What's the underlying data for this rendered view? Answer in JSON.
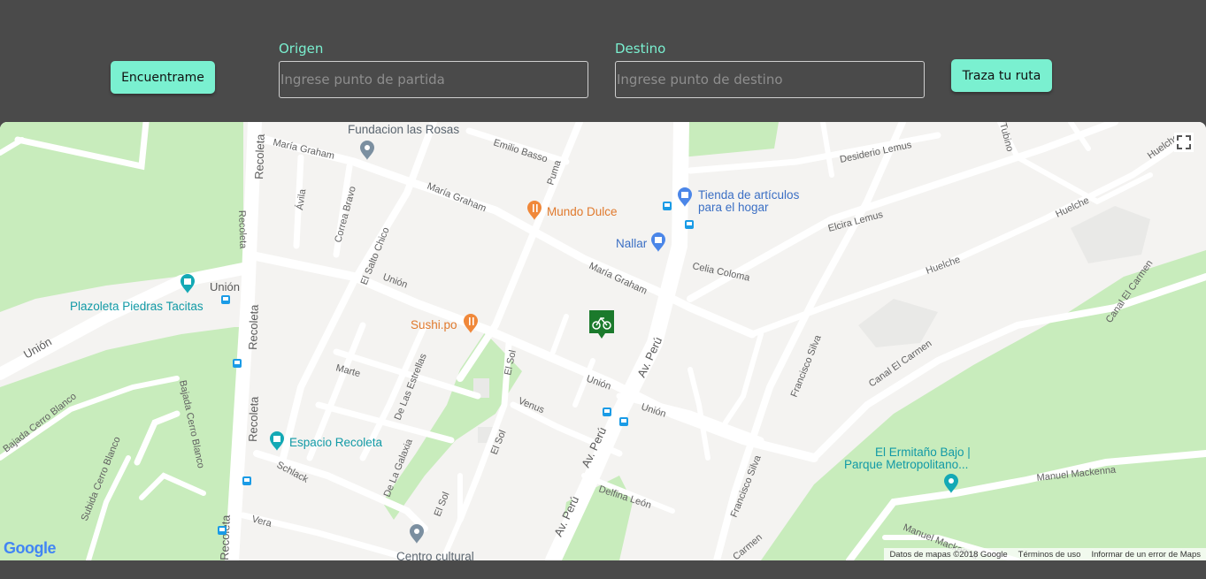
{
  "header": {
    "find_me": "Encuentrame",
    "origin": {
      "label": "Origen",
      "placeholder": "Ingrese punto de partida"
    },
    "destination": {
      "label": "Destino",
      "placeholder": "Ingrese punto de destino"
    },
    "route": "Traza tu ruta"
  },
  "map": {
    "pois": {
      "fundacion": "Fundacion las Rosas",
      "mundo_dulce": "Mundo Dulce",
      "tienda_1": "Tienda de artículos",
      "tienda_2": "para el hogar",
      "nallar": "Nallar",
      "plazoleta": "Plazoleta Piedras Tacitas",
      "sushi": "Sushi.po",
      "espacio": "Espacio Recoleta",
      "ermitano_1": "El Ermitaño Bajo |",
      "ermitano_2": "Parque Metropolitano...",
      "centro": "Centro cultural"
    },
    "streets": {
      "maria_graham_1": "María Graham",
      "maria_graham_2": "María Graham",
      "maria_graham_3": "María Graham",
      "emilio_basso": "Emilio Basso",
      "puma": "Puma",
      "avila": "Ávila",
      "correa_bravo": "Correa Bravo",
      "recoleta_1": "Recoleta",
      "recoleta_2": "Recoleta",
      "recoleta_3": "Recoleta",
      "recoleta_4": "Recoleta",
      "recoleta_5": "Recoleta",
      "union_1": "Unión",
      "union_2": "Unión",
      "union_3": "Unión",
      "union_4": "Unión",
      "union_5": "Unión",
      "el_salto_chico": "El Salto Chico",
      "marte": "Marte",
      "de_las_estrellas": "De Las Estrellas",
      "el_sol_1": "El Sol",
      "el_sol_2": "El Sol",
      "el_sol_3": "El Sol",
      "venus": "Venus",
      "de_la_galaxia": "De La Galaxia",
      "schlack": "Schlack",
      "vera": "Vera",
      "av_peru_1": "Av. Perú",
      "av_peru_2": "Av. Perú",
      "av_peru_3": "Av. Perú",
      "delfina_leon": "Delfina León",
      "celia_coloma": "Celia Coloma",
      "elcira_lemus": "Elcira Lemus",
      "desiderio_lemus": "Desiderio Lemus",
      "huelche_1": "Huelche",
      "huelche_2": "Huelche",
      "huelche_3": "Huelche",
      "tubino": "Tubino",
      "francisco_silva_1": "Francisco Silva",
      "francisco_silva_2": "Francisco Silva",
      "canal_el_carmen_1": "Canal El Carmen",
      "canal_el_carmen_2": "Canal El Carmen",
      "carmen": "Carmen",
      "manuel_mackenna_1": "Manuel Mackenna",
      "manuel_mackenna_2": "Manuel Mackenna",
      "bajada_cerro_blanco_1": "Bajada Cerro Blanco",
      "bajada_cerro_blanco_2": "Bajada Cerro Blanco",
      "subida_cerro_blanco": "Subida Cerro Blanco"
    },
    "google_logo": "Google",
    "attribution": {
      "data": "Datos de mapas ©2018 Google",
      "terms": "Términos de uso",
      "report": "Informar de un error de Maps"
    },
    "colors": {
      "park": "#c8ecbc",
      "road": "#ffffff",
      "land": "#f4f3f1",
      "teal_poi": "#14a9b5",
      "orange_poi": "#f0883a",
      "blue_poi": "#4b86e8",
      "bike": "#1b7a2c"
    },
    "icons": [
      "location-pin-icon",
      "restaurant-icon",
      "shopping-bag-icon",
      "museum-icon",
      "camera-icon",
      "bus-stop-icon",
      "bicycle-icon",
      "fullscreen-icon"
    ]
  }
}
